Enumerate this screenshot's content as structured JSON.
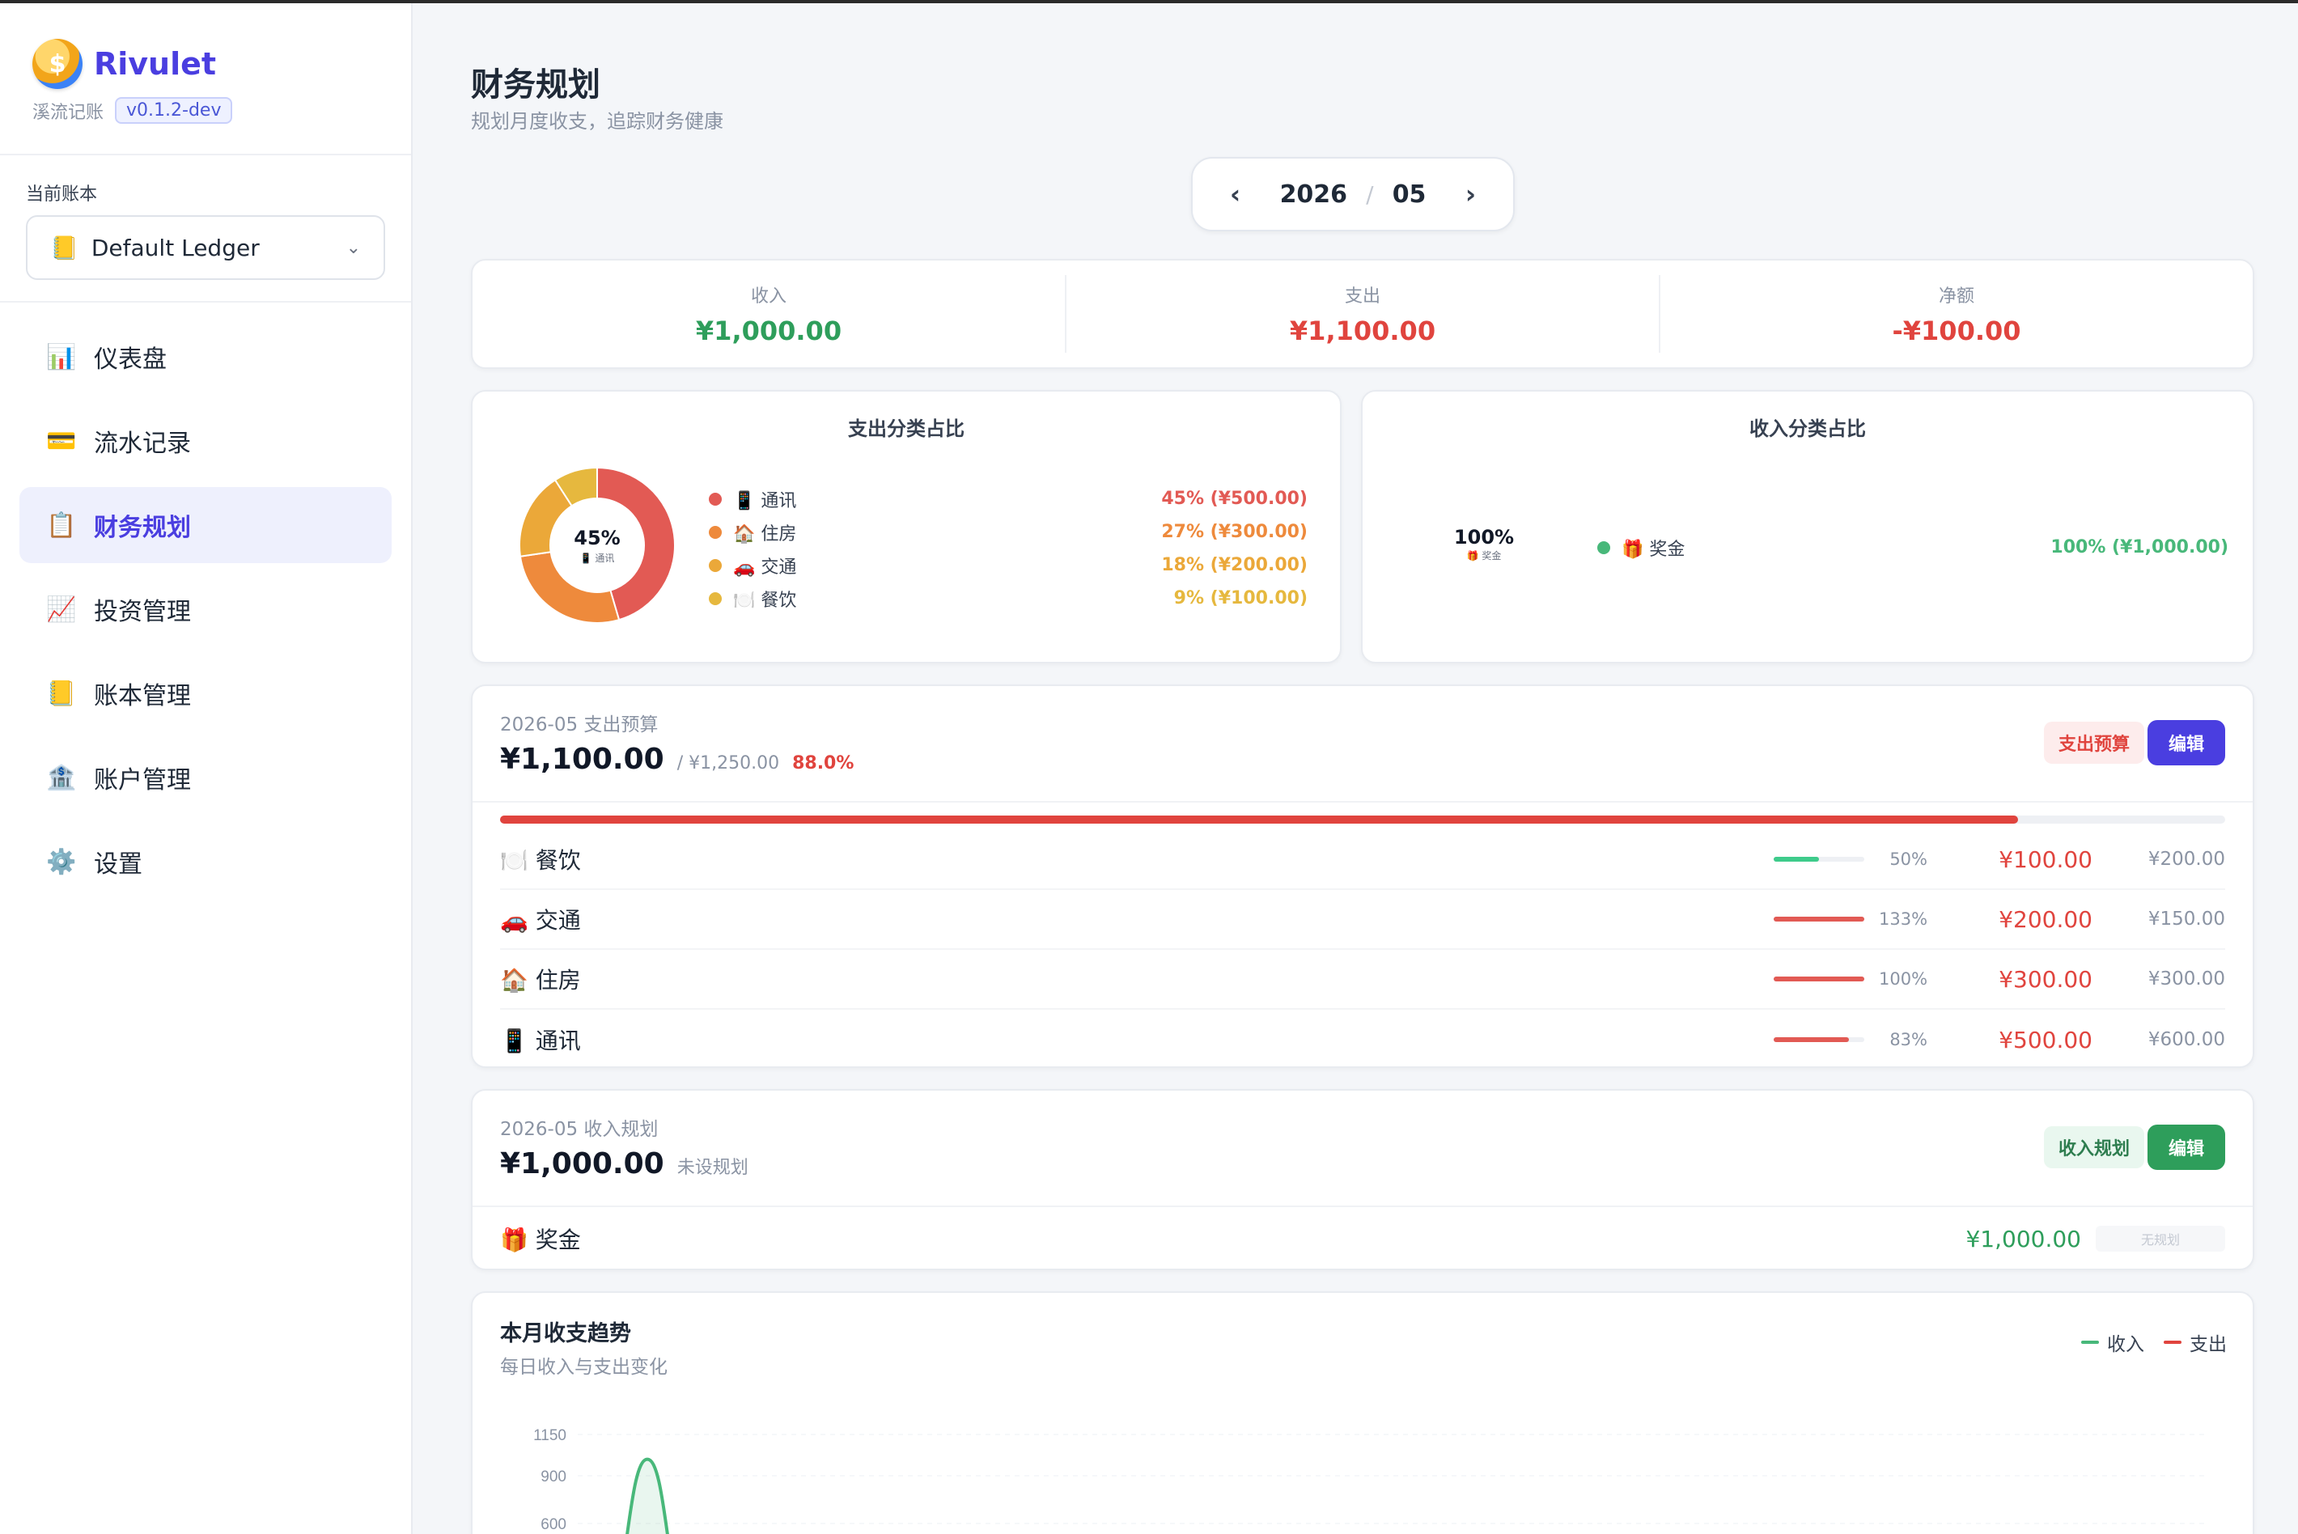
{
  "app": {
    "name": "Rivulet",
    "subtitle": "溪流记账",
    "version": "v0.1.2-dev",
    "logo_glyph": "$"
  },
  "ledger": {
    "label": "当前账本",
    "selected": "Default Ledger",
    "icon": "ledger-icon"
  },
  "nav": [
    {
      "label": "仪表盘",
      "icon": "📊",
      "active": false
    },
    {
      "label": "流水记录",
      "icon": "💳",
      "active": false
    },
    {
      "label": "财务规划",
      "icon": "📋",
      "active": true
    },
    {
      "label": "投资管理",
      "icon": "📈",
      "active": false
    },
    {
      "label": "账本管理",
      "icon": "📒",
      "active": false
    },
    {
      "label": "账户管理",
      "icon": "🏦",
      "active": false
    },
    {
      "label": "设置",
      "icon": "⚙️",
      "active": false
    }
  ],
  "page": {
    "title": "财务规划",
    "subtitle": "规划月度收支，追踪财务健康"
  },
  "month_picker": {
    "prev": "‹",
    "next": "›",
    "year": "2026",
    "separator": "/",
    "month": "05"
  },
  "summary": [
    {
      "label": "收入",
      "value": "¥1,000.00",
      "color": "#2e9e5b"
    },
    {
      "label": "支出",
      "value": "¥1,100.00",
      "color": "#e0443e"
    },
    {
      "label": "净额",
      "value": "-¥100.00",
      "color": "#e0443e"
    }
  ],
  "expense_pie": {
    "title": "支出分类占比",
    "center_pct": "45%",
    "center_label": "📱 通讯",
    "slices": [
      {
        "label": "📱 通讯",
        "value_text": "45% (¥500.00)",
        "fraction": 0.4545,
        "color": "#e25a54"
      },
      {
        "label": "🏠 住房",
        "value_text": "27% (¥300.00)",
        "fraction": 0.2727,
        "color": "#ee8a3c"
      },
      {
        "label": "🚗 交通",
        "value_text": "18% (¥200.00)",
        "fraction": 0.1818,
        "color": "#eba839"
      },
      {
        "label": "🍽️ 餐饮",
        "value_text": "9% (¥100.00)",
        "fraction": 0.0909,
        "color": "#e6b83e"
      }
    ]
  },
  "income_pie": {
    "title": "收入分类占比",
    "center_pct": "100%",
    "center_label": "🎁 奖金",
    "slices": [
      {
        "label": "🎁 奖金",
        "value_text": "100% (¥1,000.00)",
        "fraction": 1.0,
        "color": "#48b87a"
      }
    ]
  },
  "budget": {
    "period_label": "2026-05 支出预算",
    "spent": "¥1,100.00",
    "total": "/ ¥1,250.00",
    "percent": "88.0%",
    "progress": 0.88,
    "badge": "支出预算",
    "edit": "编辑",
    "rows": [
      {
        "category": "🍽️ 餐饮",
        "percent": "50%",
        "progress": 0.5,
        "bar_color": "#3ecb8b",
        "spent": "¥100.00",
        "limit": "¥200.00"
      },
      {
        "category": "🚗 交通",
        "percent": "133%",
        "progress": 1.0,
        "bar_color": "#e25a54",
        "spent": "¥200.00",
        "limit": "¥150.00"
      },
      {
        "category": "🏠 住房",
        "percent": "100%",
        "progress": 1.0,
        "bar_color": "#e25a54",
        "spent": "¥300.00",
        "limit": "¥300.00"
      },
      {
        "category": "📱 通讯",
        "percent": "83%",
        "progress": 0.83,
        "bar_color": "#e25a54",
        "spent": "¥500.00",
        "limit": "¥600.00"
      }
    ]
  },
  "income_plan": {
    "period_label": "2026-05 收入规划",
    "amount": "¥1,000.00",
    "note": "未设规划",
    "badge": "收入规划",
    "edit": "编辑",
    "rows": [
      {
        "category": "🎁 奖金",
        "amount": "¥1,000.00",
        "plan": "无规划"
      }
    ]
  },
  "trend": {
    "title": "本月收支趋势",
    "subtitle": "每日收入与支出变化",
    "legend_income": "收入",
    "legend_expense": "支出",
    "income_color": "#48b87a",
    "expense_color": "#e0443e"
  },
  "chart_data": {
    "type": "line",
    "title": "本月收支趋势",
    "y_ticks": [
      "1150",
      "900",
      "600"
    ],
    "series": [
      {
        "name": "收入",
        "peak": 1000
      },
      {
        "name": "支出"
      }
    ]
  }
}
